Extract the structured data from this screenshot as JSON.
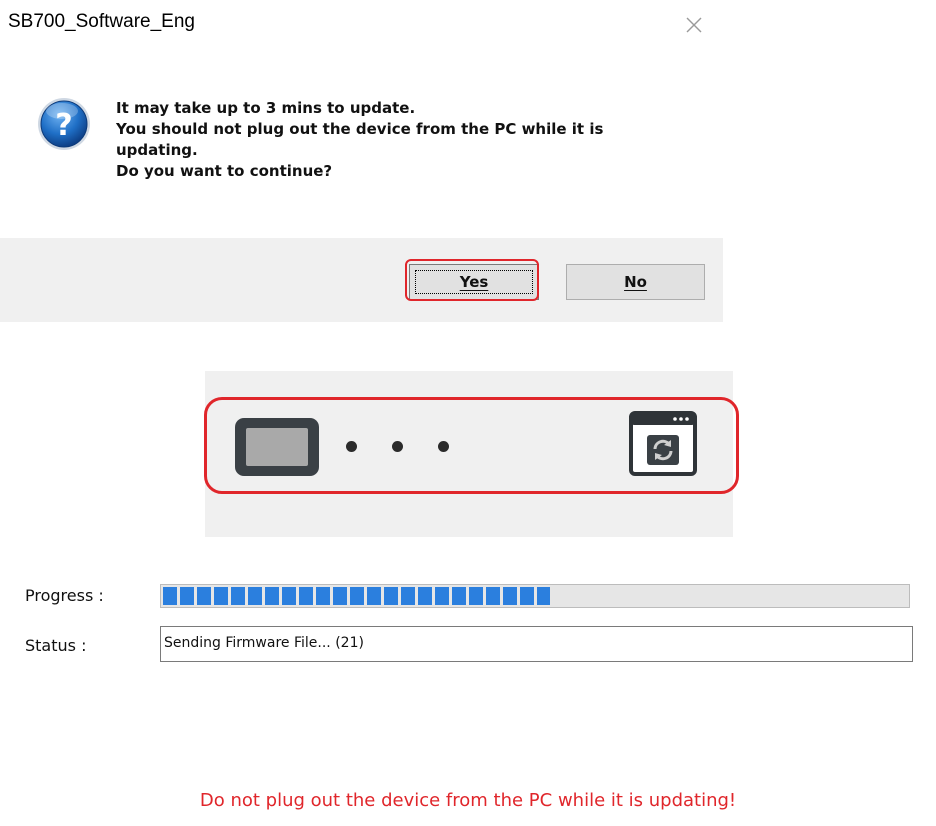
{
  "dialog": {
    "title": "SB700_Software_Eng",
    "icon": "question-icon",
    "close_icon": "close-icon",
    "message_lines": [
      "It may take up to 3 mins to update.",
      "You should not plug out the device from the PC while it is",
      "updating.",
      "Do you want to continue?"
    ],
    "buttons": {
      "yes_label": "Yes",
      "no_label": "No"
    },
    "highlight_color": "#e0262b"
  },
  "updater": {
    "icons": [
      "device-icon",
      "dots-icon",
      "update-window-icon"
    ],
    "progress_label": "Progress :",
    "progress_fraction": 0.52,
    "progress_color": "#2b7fde",
    "status_label": "Status :",
    "status_value": "Sending Firmware File... (21)",
    "warning": "Do not plug out the device from the PC while it is updating!",
    "warning_color": "#e0262b"
  }
}
